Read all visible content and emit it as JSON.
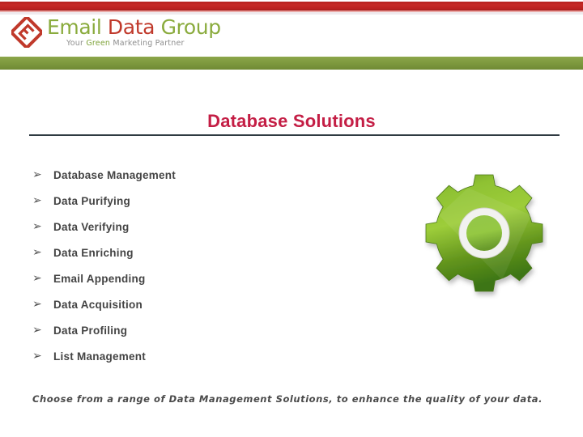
{
  "header": {
    "logo": {
      "icon_name": "diamond-e-logo-mark",
      "word_1": "Email",
      "word_2": "Data",
      "word_3": "Group",
      "tagline_pre": "Your ",
      "tagline_green": "Green",
      "tagline_post": " Marketing Partner"
    },
    "colors": {
      "top_bar_red": "#bb2220",
      "green_band": "#7f9a3f",
      "logo_green": "#8aab3d",
      "logo_red": "#c0392b"
    }
  },
  "slide": {
    "title": "Database Solutions",
    "title_color": "#c41e45",
    "bullet_glyph": "➢",
    "items": [
      {
        "label": "Database Management"
      },
      {
        "label": "Data Purifying"
      },
      {
        "label": "Data Verifying"
      },
      {
        "label": "Data Enriching"
      },
      {
        "label": "Email Appending"
      },
      {
        "label": "Data Acquisition"
      },
      {
        "label": "Data Profiling"
      },
      {
        "label": "List Management"
      }
    ],
    "graphic": {
      "icon_name": "gear-icon",
      "teeth": 12,
      "color_light": "#9ac93a",
      "color_dark": "#3f7a16"
    },
    "footer_note": "Choose from a range of Data Management Solutions, to enhance the quality of your data."
  }
}
